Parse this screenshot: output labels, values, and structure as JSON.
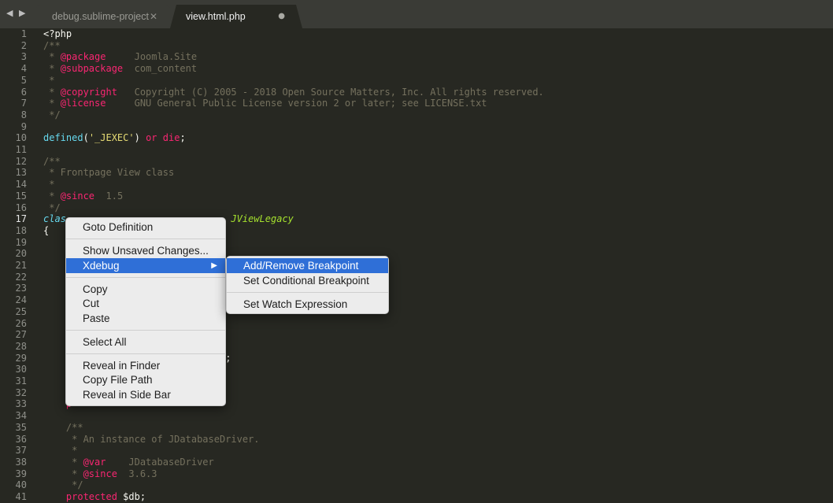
{
  "tabs": [
    {
      "label": "debug.sublime-project",
      "close": "✕",
      "active": false
    },
    {
      "label": "view.html.php",
      "close": "●",
      "active": true
    }
  ],
  "nav_arrows": "◀ ▶",
  "code_lines": [
    [
      {
        "c": "t-default",
        "t": "<?php"
      }
    ],
    [
      {
        "c": "t-comment",
        "t": "/**"
      }
    ],
    [
      {
        "c": "t-comment",
        "t": " * "
      },
      {
        "c": "t-tag",
        "t": "@package"
      },
      {
        "c": "t-comment",
        "t": "     Joomla.Site"
      }
    ],
    [
      {
        "c": "t-comment",
        "t": " * "
      },
      {
        "c": "t-tag",
        "t": "@subpackage"
      },
      {
        "c": "t-comment",
        "t": "  com_content"
      }
    ],
    [
      {
        "c": "t-comment",
        "t": " *"
      }
    ],
    [
      {
        "c": "t-comment",
        "t": " * "
      },
      {
        "c": "t-tag",
        "t": "@copyright"
      },
      {
        "c": "t-comment",
        "t": "   Copyright (C) 2005 - 2018 Open Source Matters, Inc. All rights reserved."
      }
    ],
    [
      {
        "c": "t-comment",
        "t": " * "
      },
      {
        "c": "t-tag",
        "t": "@license"
      },
      {
        "c": "t-comment",
        "t": "     GNU General Public License version 2 or later; see LICENSE.txt"
      }
    ],
    [
      {
        "c": "t-comment",
        "t": " */"
      }
    ],
    [],
    [
      {
        "c": "t-fn",
        "t": "defined"
      },
      {
        "c": "t-default",
        "t": "("
      },
      {
        "c": "t-str",
        "t": "'_JEXEC'"
      },
      {
        "c": "t-default",
        "t": ") "
      },
      {
        "c": "t-kw",
        "t": "or"
      },
      {
        "c": "t-default",
        "t": " "
      },
      {
        "c": "t-kw",
        "t": "die"
      },
      {
        "c": "t-default",
        "t": ";"
      }
    ],
    [],
    [
      {
        "c": "t-comment",
        "t": "/**"
      }
    ],
    [
      {
        "c": "t-comment",
        "t": " * Frontpage View class"
      }
    ],
    [
      {
        "c": "t-comment",
        "t": " *"
      }
    ],
    [
      {
        "c": "t-comment",
        "t": " * "
      },
      {
        "c": "t-tag",
        "t": "@since"
      },
      {
        "c": "t-comment",
        "t": "  1.5"
      }
    ],
    [
      {
        "c": "t-comment",
        "t": " */"
      }
    ],
    [
      {
        "c": "t-class",
        "t": "clas"
      },
      {
        "c": "t-default",
        "t": "                             "
      },
      {
        "c": "t-inh",
        "t": "JViewLegacy"
      }
    ],
    [
      {
        "c": "t-default",
        "t": "{"
      }
    ],
    [],
    [],
    [],
    [],
    [],
    [],
    [],
    [],
    [
      {
        "c": "t-default",
        "t": "                              );"
      }
    ],
    [],
    [
      {
        "c": "t-default",
        "t": "                              ();"
      }
    ],
    [],
    [
      {
        "c": "t-default",
        "t": "                              );"
      }
    ],
    [],
    [
      {
        "c": "t-kw",
        "t": "    p"
      }
    ],
    [],
    [
      {
        "c": "t-comment",
        "t": "    /**"
      }
    ],
    [
      {
        "c": "t-comment",
        "t": "     * An instance of JDatabaseDriver."
      }
    ],
    [
      {
        "c": "t-comment",
        "t": "     *"
      }
    ],
    [
      {
        "c": "t-comment",
        "t": "     * "
      },
      {
        "c": "t-tag",
        "t": "@var"
      },
      {
        "c": "t-comment",
        "t": "    JDatabaseDriver"
      }
    ],
    [
      {
        "c": "t-comment",
        "t": "     * "
      },
      {
        "c": "t-tag",
        "t": "@since"
      },
      {
        "c": "t-comment",
        "t": "  3.6.3"
      }
    ],
    [
      {
        "c": "t-comment",
        "t": "     */"
      }
    ],
    [
      {
        "c": "t-kw",
        "t": "    protected"
      },
      {
        "c": "t-default",
        "t": " $db;"
      }
    ]
  ],
  "current_line": 17,
  "context_menu": {
    "items": [
      {
        "label": "Goto Definition"
      },
      {
        "sep": true
      },
      {
        "label": "Show Unsaved Changes..."
      },
      {
        "label": "Xdebug",
        "submenu": true,
        "highlight": true,
        "arrow": "▶"
      },
      {
        "sep": true
      },
      {
        "label": "Copy"
      },
      {
        "label": "Cut"
      },
      {
        "label": "Paste"
      },
      {
        "sep": true
      },
      {
        "label": "Select All"
      },
      {
        "sep": true
      },
      {
        "label": "Reveal in Finder"
      },
      {
        "label": "Copy File Path"
      },
      {
        "label": "Reveal in Side Bar"
      }
    ]
  },
  "submenu": {
    "items": [
      {
        "label": "Add/Remove Breakpoint",
        "highlight": true
      },
      {
        "label": "Set Conditional Breakpoint"
      },
      {
        "sep": true
      },
      {
        "label": "Set Watch Expression"
      }
    ]
  }
}
